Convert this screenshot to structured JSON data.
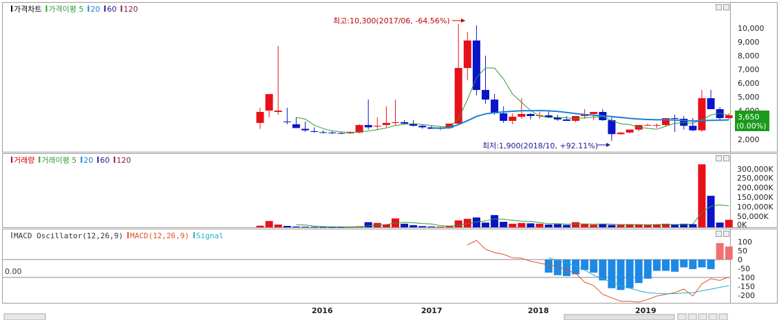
{
  "price_panel": {
    "legend": [
      {
        "label": "가격차트",
        "marker": "#000000",
        "color": "#000000"
      },
      {
        "label": "가격이평 5",
        "marker": "#2e9b2e",
        "color": "#2e9b2e"
      },
      {
        "label": "20",
        "marker": "#1a7fd8",
        "color": "#1a7fd8"
      },
      {
        "label": "60",
        "marker": "#1a1a9a",
        "color": "#1a1a9a"
      },
      {
        "label": "120",
        "marker": "#8a1a3a",
        "color": "#8a1a3a"
      }
    ],
    "y_ticks": [
      "10,000",
      "9,000",
      "8,000",
      "7,000",
      "6,000",
      "5,000",
      "4,000",
      "2,000"
    ],
    "high_annotation": "최고:10,300(2017/06, -64.56%)",
    "low_annotation": "최저:1,900(2018/10, +92.11%)",
    "current_price": "3,650",
    "current_change": "(0.00%)"
  },
  "volume_panel": {
    "legend": [
      {
        "label": "거래량",
        "marker": "#cc0000",
        "color": "#cc0000"
      },
      {
        "label": "거래이평 5",
        "marker": "#2e9b2e",
        "color": "#2e9b2e"
      },
      {
        "label": "20",
        "marker": "#1a7fd8",
        "color": "#1a7fd8"
      },
      {
        "label": "60",
        "marker": "#1a1a9a",
        "color": "#1a1a9a"
      },
      {
        "label": "120",
        "marker": "#8a1a3a",
        "color": "#8a1a3a"
      }
    ],
    "y_ticks": [
      "300,000K",
      "250,000K",
      "200,000K",
      "150,000K",
      "100,000K",
      "50,000K",
      "0K"
    ]
  },
  "macd_panel": {
    "legend": [
      {
        "label": "MACD Oscillator(12,26,9)",
        "marker": "#888888",
        "color": "#333333"
      },
      {
        "label": "MACD(12,26,9)",
        "marker": "#e05020",
        "color": "#e05020"
      },
      {
        "label": "Signal",
        "marker": "#20b0c0",
        "color": "#20b0c0"
      }
    ],
    "y_ticks": [
      "100",
      "50",
      "0",
      "-50",
      "-100",
      "-150",
      "-200"
    ],
    "left_label": "0.00"
  },
  "x_axis": {
    "labels": [
      "2016",
      "2017",
      "2018",
      "2019"
    ]
  },
  "colors": {
    "up": "#e8111a",
    "down": "#0a14c8",
    "ma5": "#2e9b2e",
    "ma20": "#1a7fd8",
    "macd": "#e05020",
    "signal": "#20b0c0",
    "osc": "#1e88e5",
    "osc_pos": "#f07070"
  },
  "chart_data": {
    "type": "candlestick",
    "interval": "monthly",
    "x": [
      "2015/07",
      "2015/08",
      "2015/09",
      "2015/10",
      "2015/11",
      "2015/12",
      "2016/01",
      "2016/02",
      "2016/03",
      "2016/04",
      "2016/05",
      "2016/06",
      "2016/07",
      "2016/08",
      "2016/09",
      "2016/10",
      "2016/11",
      "2016/12",
      "2017/01",
      "2017/02",
      "2017/03",
      "2017/04",
      "2017/05",
      "2017/06",
      "2017/07",
      "2017/08",
      "2017/09",
      "2017/10",
      "2017/11",
      "2017/12",
      "2018/01",
      "2018/02",
      "2018/03",
      "2018/04",
      "2018/05",
      "2018/06",
      "2018/07",
      "2018/08",
      "2018/09",
      "2018/10",
      "2018/11",
      "2018/12",
      "2019/01",
      "2019/02",
      "2019/03",
      "2019/04",
      "2019/05",
      "2019/06",
      "2019/07",
      "2019/08",
      "2019/09",
      "2019/10"
    ],
    "x_labels": [
      "2016",
      "2017",
      "2018",
      "2019"
    ],
    "open": [
      3100,
      4000,
      3900,
      3200,
      3000,
      2700,
      2550,
      2480,
      2450,
      2420,
      2400,
      2450,
      2950,
      2850,
      2950,
      3100,
      3150,
      3050,
      2900,
      2800,
      2700,
      2750,
      3050,
      7100,
      9100,
      5500,
      4800,
      3800,
      3250,
      3550,
      3750,
      3600,
      3650,
      3500,
      3350,
      3250,
      3600,
      3750,
      3900,
      3300,
      2350,
      2450,
      2650,
      2950,
      2950,
      2950,
      3450,
      3400,
      2900,
      2600,
      4900,
      4100,
      3450
    ],
    "high": [
      4200,
      5000,
      8700,
      4200,
      3500,
      3200,
      2800,
      2600,
      2550,
      2500,
      2550,
      3000,
      4800,
      3500,
      4300,
      4800,
      3300,
      3300,
      3000,
      2900,
      2850,
      3000,
      10300,
      9700,
      10200,
      8000,
      5200,
      4300,
      3800,
      4900,
      3800,
      3900,
      4000,
      3700,
      3600,
      3500,
      4100,
      3850,
      4100,
      3500,
      2500,
      2650,
      2900,
      3050,
      3050,
      3150,
      3700,
      3600,
      3450,
      5500,
      5500,
      4250,
      3800
    ],
    "low": [
      2700,
      3500,
      3700,
      3000,
      2800,
      2500,
      2450,
      2380,
      2350,
      2350,
      2350,
      2400,
      2650,
      2650,
      2800,
      2900,
      3000,
      2850,
      2700,
      2700,
      2600,
      2700,
      2950,
      6200,
      5100,
      4500,
      3700,
      3100,
      3000,
      3400,
      3350,
      3400,
      3450,
      3250,
      3250,
      3150,
      3400,
      3300,
      3250,
      1900,
      2300,
      2400,
      2550,
      2900,
      2750,
      2850,
      2500,
      2650,
      2550,
      2500,
      4100,
      3300,
      3350
    ],
    "close": [
      3900,
      5200,
      4000,
      3150,
      2750,
      2600,
      2500,
      2450,
      2420,
      2400,
      2450,
      2950,
      2800,
      2900,
      3100,
      3150,
      3050,
      2900,
      2800,
      2700,
      2750,
      3050,
      7100,
      9100,
      5500,
      4800,
      3800,
      3250,
      3550,
      3750,
      3600,
      3650,
      3500,
      3350,
      3250,
      3600,
      3750,
      3900,
      3300,
      2350,
      2450,
      2650,
      2950,
      2950,
      2950,
      3450,
      3400,
      2900,
      2600,
      4900,
      4100,
      3450,
      3650
    ],
    "ma5": [
      null,
      null,
      null,
      null,
      3500,
      3380,
      2940,
      2720,
      2560,
      2500,
      2460,
      2500,
      2560,
      2640,
      2760,
      2920,
      3000,
      3040,
      2990,
      2920,
      2850,
      2800,
      3400,
      4800,
      6400,
      7100,
      7100,
      6300,
      5200,
      4600,
      4000,
      3600,
      3500,
      3500,
      3460,
      3420,
      3470,
      3520,
      3560,
      3280,
      3030,
      2980,
      2800,
      2730,
      2670,
      2870,
      3070,
      3130,
      3070,
      3330,
      3680,
      3800,
      3650
    ],
    "ma20": [
      null,
      null,
      null,
      null,
      null,
      null,
      null,
      null,
      null,
      null,
      null,
      null,
      null,
      null,
      null,
      null,
      null,
      null,
      null,
      2760,
      2740,
      2770,
      2980,
      3260,
      3570,
      3760,
      3850,
      3900,
      3950,
      3990,
      3990,
      4000,
      3980,
      3940,
      3860,
      3780,
      3710,
      3660,
      3620,
      3560,
      3500,
      3430,
      3380,
      3350,
      3330,
      3330,
      3310,
      3280,
      3240,
      3270,
      3290,
      3300,
      3320
    ],
    "volume_k": [
      8000,
      32000,
      14000,
      7000,
      4000,
      3000,
      2000,
      2000,
      1500,
      1500,
      2000,
      5000,
      26000,
      22000,
      14000,
      45000,
      18000,
      11000,
      6000,
      4000,
      3000,
      5000,
      35000,
      43000,
      50000,
      24000,
      62000,
      28000,
      18000,
      22000,
      20000,
      18000,
      14000,
      16000,
      12000,
      26000,
      16000,
      13000,
      16000,
      12000,
      12000,
      16000,
      14000,
      12000,
      14000,
      18000,
      14000,
      18000,
      16000,
      320000,
      160000,
      24000,
      38000
    ],
    "volume_ma5": [
      null,
      null,
      null,
      null,
      13000,
      12000,
      5800,
      3600,
      2500,
      2000,
      1800,
      2400,
      7400,
      11400,
      14000,
      22000,
      25000,
      23000,
      19000,
      17000,
      8400,
      5800,
      10600,
      18000,
      27000,
      32000,
      43000,
      41000,
      36000,
      31000,
      30000,
      24000,
      18000,
      18000,
      16000,
      17000,
      17000,
      16000,
      17000,
      16000,
      14000,
      14000,
      14000,
      13000,
      14000,
      15000,
      14000,
      15000,
      16000,
      76000,
      106000,
      114000,
      108000
    ],
    "macd": [
      null,
      null,
      null,
      null,
      null,
      null,
      null,
      null,
      null,
      null,
      null,
      null,
      null,
      null,
      null,
      null,
      null,
      null,
      null,
      null,
      null,
      null,
      null,
      85,
      110,
      60,
      40,
      30,
      10,
      8,
      -10,
      -20,
      -30,
      -40,
      -60,
      -80,
      -130,
      -150,
      -200,
      -220,
      -240,
      -240,
      -245,
      -230,
      -210,
      -200,
      -190,
      -170,
      -210,
      -140,
      -110,
      -120,
      -100
    ],
    "signal": [
      null,
      null,
      null,
      null,
      null,
      null,
      null,
      null,
      null,
      null,
      null,
      null,
      null,
      null,
      null,
      null,
      null,
      null,
      null,
      null,
      null,
      null,
      null,
      null,
      null,
      null,
      null,
      null,
      null,
      null,
      null,
      null,
      10,
      -5,
      -20,
      -35,
      -60,
      -90,
      -110,
      -130,
      -150,
      -165,
      -180,
      -190,
      -195,
      -197,
      -196,
      -192,
      -190,
      -180,
      -170,
      -160,
      -150
    ],
    "osc": [
      null,
      null,
      null,
      null,
      null,
      null,
      null,
      null,
      null,
      null,
      null,
      null,
      null,
      null,
      null,
      null,
      null,
      null,
      null,
      null,
      null,
      null,
      null,
      null,
      null,
      null,
      null,
      null,
      null,
      null,
      null,
      null,
      -75,
      -90,
      -95,
      -85,
      -60,
      -75,
      -120,
      -165,
      -175,
      -165,
      -135,
      -110,
      -65,
      -65,
      -70,
      -45,
      -55,
      -45,
      -55,
      95,
      75
    ],
    "y_range_price": [
      1700,
      11000
    ],
    "y_range_volume_k": [
      0,
      350000
    ],
    "y_range_macd": [
      -230,
      130
    ]
  }
}
